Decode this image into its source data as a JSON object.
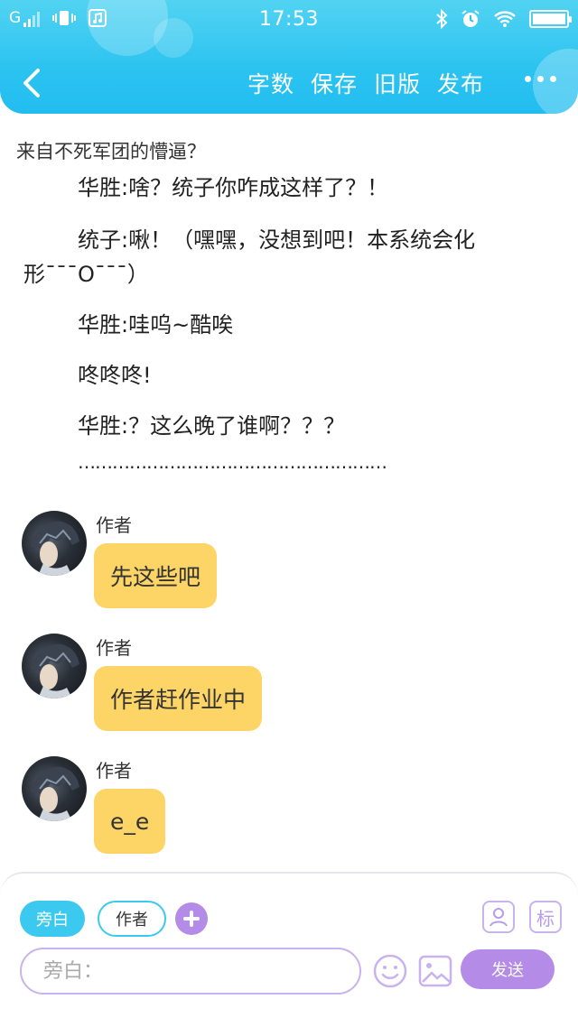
{
  "status_bar": {
    "network": "G",
    "time": "17:53"
  },
  "nav": {
    "actions": [
      "字数",
      "保存",
      "旧版",
      "发布"
    ]
  },
  "story": {
    "title": "来自不死军团的懵逼？",
    "lines": [
      "华胜:啥？统子你咋成这样了？！",
      "统子:啾！（嘿嘿，没想到吧！本系统会化",
      "形ˉˉˉOˉˉˉ）",
      "华胜:哇呜~酷唉",
      "咚咚咚!",
      "华胜:？这么晚了谁啊？？？",
      "………………………………………………"
    ]
  },
  "messages": [
    {
      "author": "作者",
      "text": "先这些吧"
    },
    {
      "author": "作者",
      "text": "作者赶作业中"
    },
    {
      "author": "作者",
      "text": "e_e"
    }
  ],
  "composer": {
    "role_narrator": "旁白",
    "role_author": "作者",
    "mark_label": "标",
    "input_placeholder": "旁白：",
    "send_label": "发送"
  },
  "colors": {
    "header": "#2cc3f0",
    "bubble": "#fcd566",
    "accent_purple": "#b48be6"
  }
}
